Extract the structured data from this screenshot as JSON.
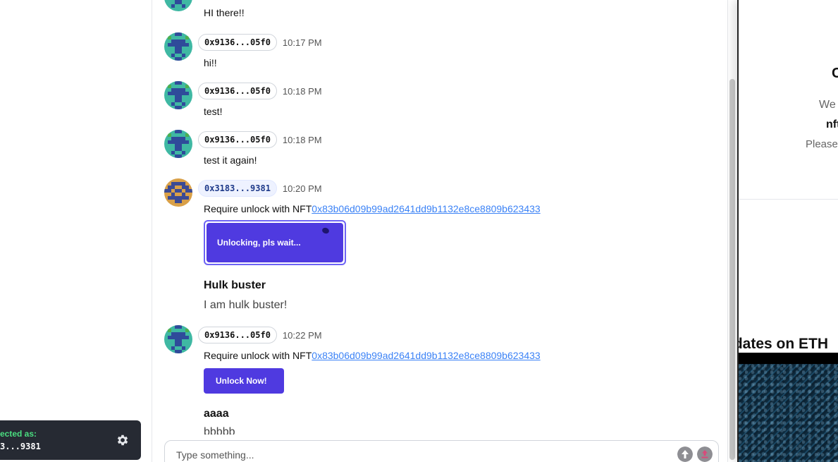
{
  "sidebar": {
    "account": {
      "label": "ected as:",
      "address": "3...9381"
    }
  },
  "messages": [
    {
      "text": "HI there!!"
    },
    {
      "author": "0x9136...05f0",
      "time": "10:17 PM",
      "text": "hi!!"
    },
    {
      "author": "0x9136...05f0",
      "time": "10:18 PM",
      "text": "test!"
    },
    {
      "author": "0x9136...05f0",
      "time": "10:18 PM",
      "text": "test it again!"
    },
    {
      "author": "0x3183...9381",
      "time": "10:20 PM",
      "text_prefix": "Require unlock with NFT",
      "nft_link": "0x83b06d09b99ad2641dd9b1132e8ce8809b623433",
      "button": "Unlocking, pls wait...",
      "nft_title": "Hulk buster",
      "nft_desc": "I am hulk buster!"
    },
    {
      "author": "0x9136...05f0",
      "time": "10:22 PM",
      "text_prefix": "Require unlock with NFT",
      "nft_link": "0x83b06d09b99ad2641dd9b1132e8ce8809b623433",
      "button": "Unlock Now!",
      "nft_title": "aaaa",
      "nft_desc": "bbbbb"
    }
  ],
  "composer": {
    "placeholder": "Type something..."
  },
  "right_panel": {
    "heading": "C",
    "line1": "We c",
    "line2": "nft",
    "line3": "Please",
    "article_title": "pdates on ETH"
  },
  "colors": {
    "accent": "#4f3ae0",
    "link": "#3b82f6",
    "account_label": "#4ade80",
    "account_bg": "#262a33"
  }
}
